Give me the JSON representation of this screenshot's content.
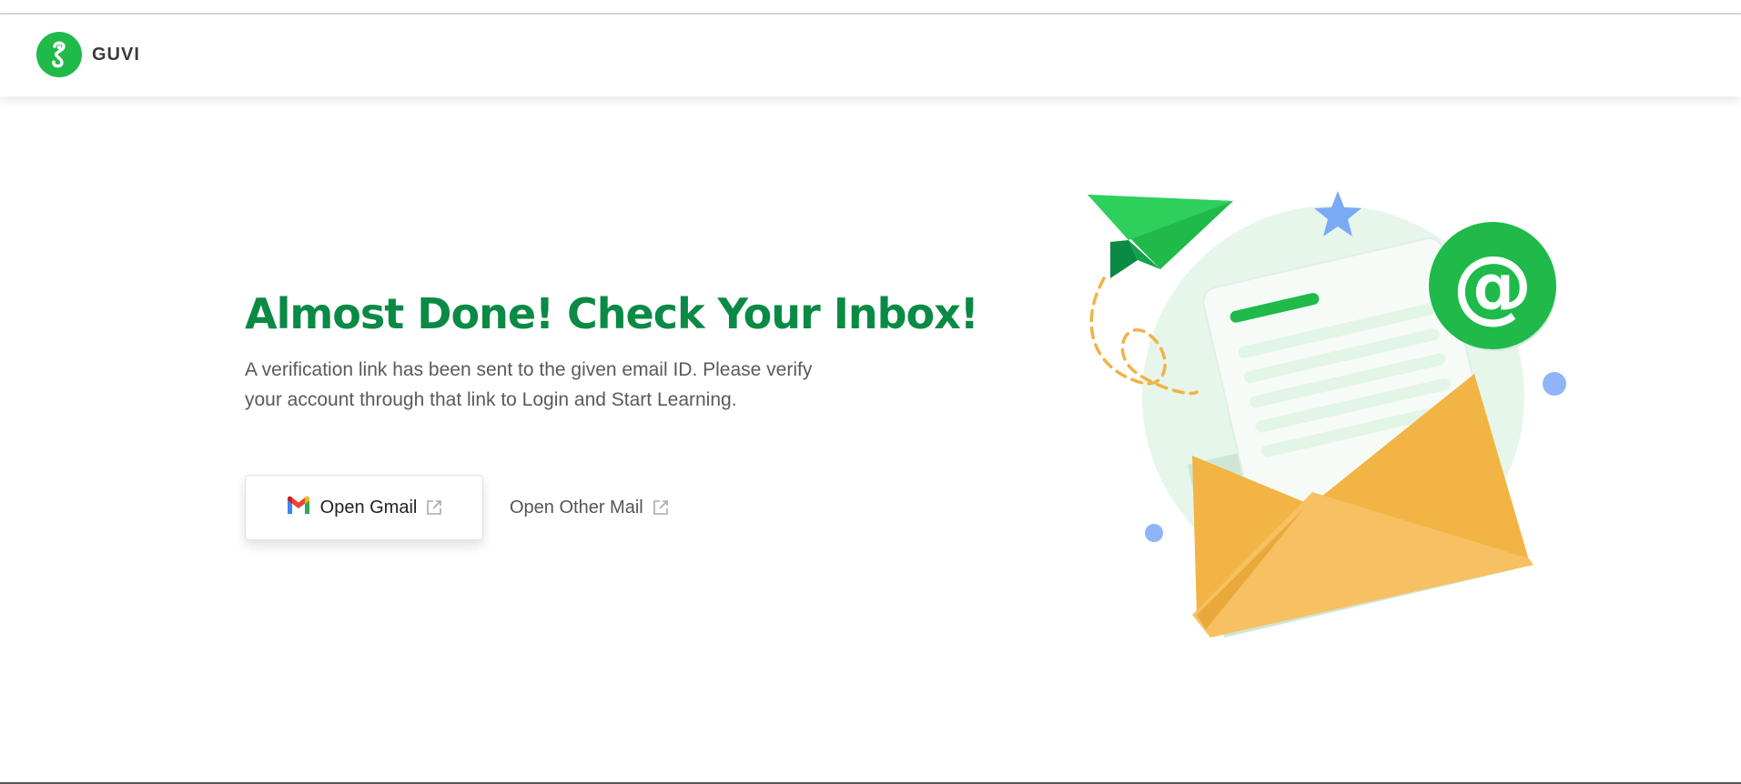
{
  "brand": {
    "name": "GUVI",
    "color": "#1fba4a"
  },
  "main": {
    "title": "Almost Done! Check Your Inbox!",
    "description": "A verification link has been sent to the given email ID. Please verify your account through that link to Login and Start Learning.",
    "title_color": "#0a8a45"
  },
  "actions": {
    "gmail_label": "Open Gmail",
    "other_label": "Open Other Mail"
  },
  "icons": {
    "logo": "guvi-logo-icon",
    "gmail": "gmail-icon",
    "external": "external-link-icon",
    "illustration": "envelope-paper-plane-illustration"
  }
}
